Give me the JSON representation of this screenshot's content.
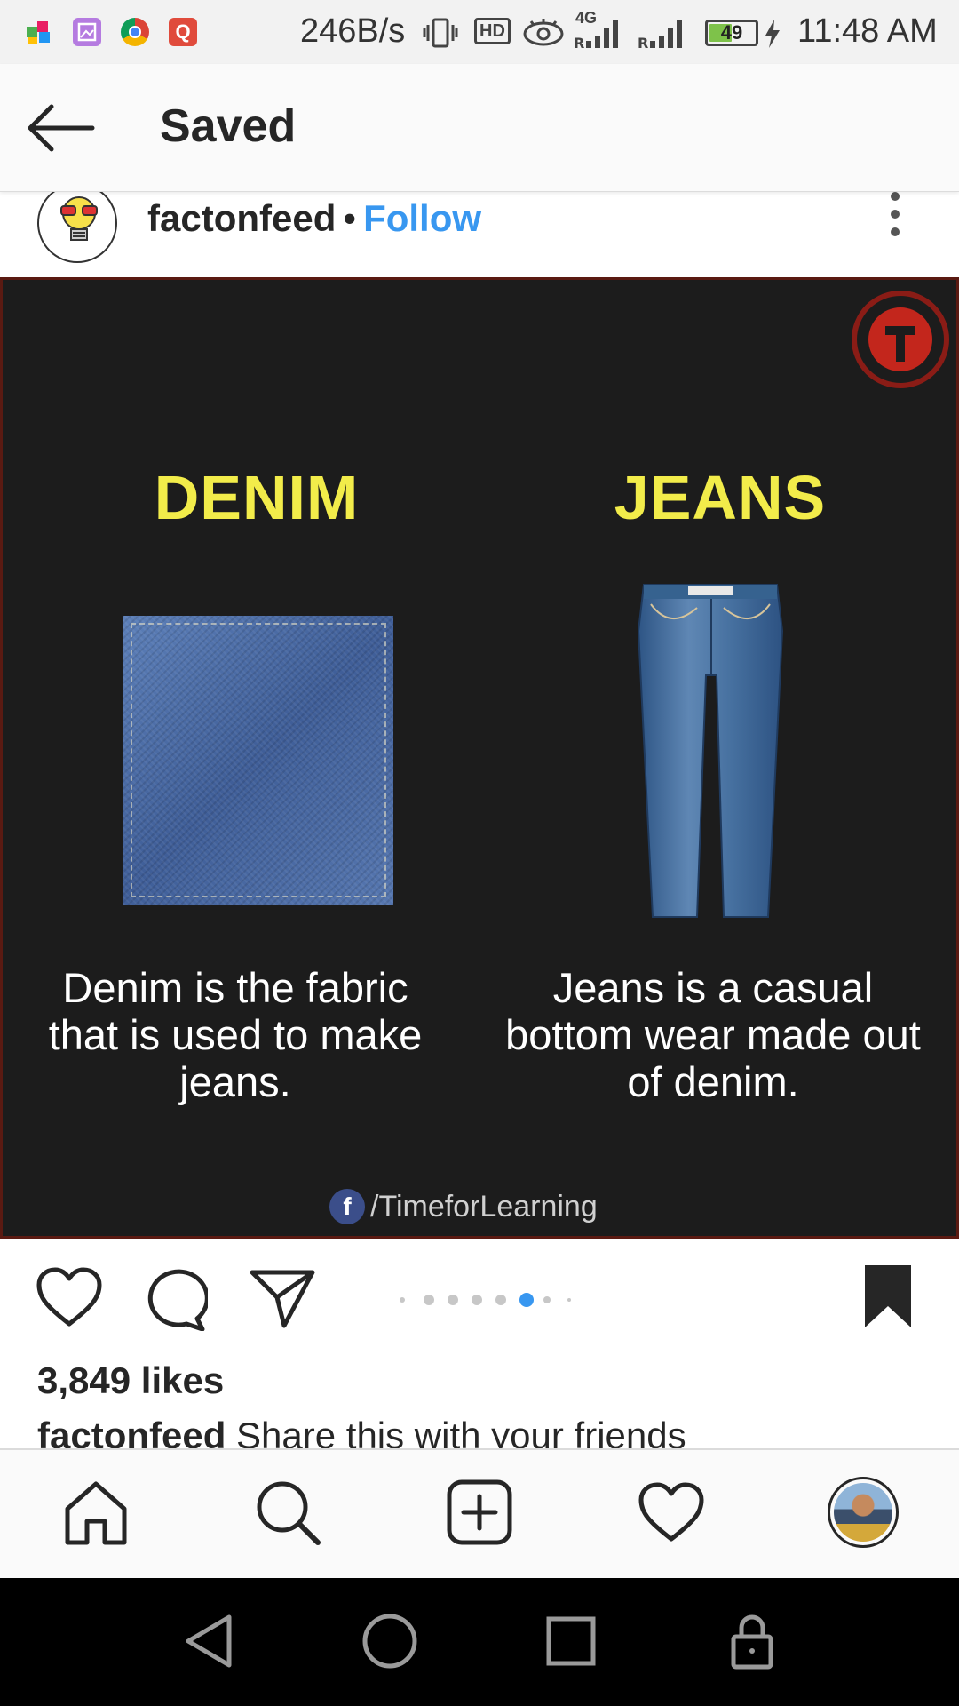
{
  "status_bar": {
    "network_speed": "246B/s",
    "hd_badge": "HD",
    "network_type": "4G",
    "battery_level": "49",
    "battery_fraction": 0.49,
    "time": "11:48 AM",
    "app_icons": [
      "puzzle-app-icon",
      "gallery-app-icon",
      "chrome-icon",
      "q-app-icon"
    ]
  },
  "header": {
    "title": "Saved"
  },
  "post": {
    "username": "factonfeed",
    "separator": "•",
    "follow_label": "Follow",
    "image": {
      "left_title": "DENIM",
      "right_title": "JEANS",
      "left_description": "Denim is the fabric that is used to make jeans.",
      "right_description": "Jeans is a casual bottom wear made out of denim.",
      "credit_icon": "f",
      "credit_text": "/TimeforLearning",
      "title_color": "#f2ec4a",
      "background_color": "#1c1c1c"
    },
    "carousel": {
      "total": 8,
      "active_index": 5
    },
    "likes": "3,849 likes",
    "caption_user": "factonfeed",
    "caption_text": "Share this with your friends"
  },
  "colors": {
    "accent": "#3897f0",
    "text": "#262626"
  }
}
